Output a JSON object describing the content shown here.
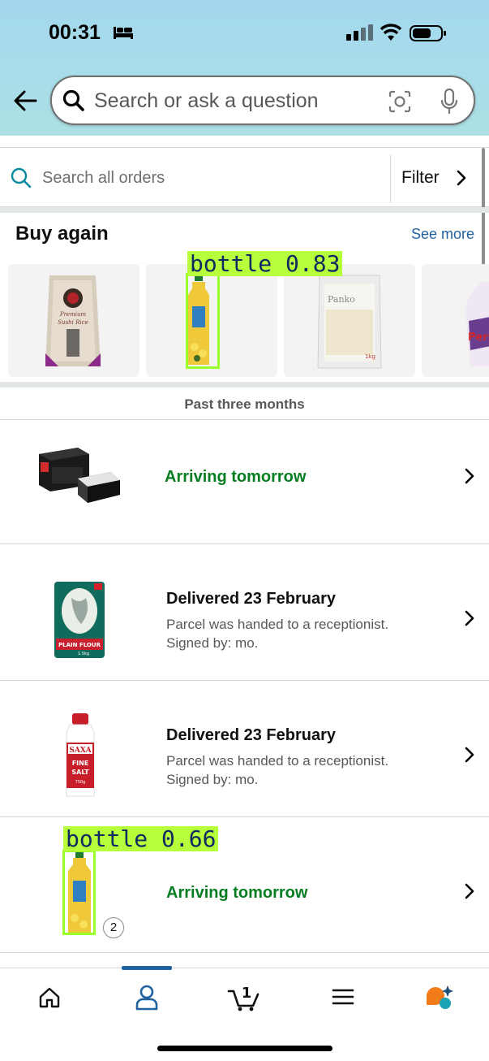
{
  "status_bar": {
    "time": "00:31"
  },
  "header": {
    "search_placeholder": "Search or ask a question"
  },
  "orders_search": {
    "placeholder": "Search all orders",
    "filter_label": "Filter"
  },
  "buy_again": {
    "title": "Buy again",
    "see_more": "See more",
    "products": [
      {
        "name": "Premium Sushi Rice"
      },
      {
        "name": "Vegetable Oil"
      },
      {
        "name": "Panko"
      },
      {
        "name": "Persil"
      }
    ]
  },
  "detections": [
    {
      "label": "bottle 0.83"
    },
    {
      "label": "bottle 0.66"
    }
  ],
  "section_label": "Past three months",
  "orders": [
    {
      "status": "Arriving tomorrow"
    },
    {
      "status": "Delivered 23 February",
      "detail_1": "Parcel was handed to a receptionist.",
      "detail_2": "Signed by: mo."
    },
    {
      "status": "Delivered 23 February",
      "detail_1": "Parcel was handed to a receptionist.",
      "detail_2": "Signed by: mo."
    },
    {
      "status": "Arriving tomorrow",
      "quantity": "2"
    }
  ],
  "bottom_nav": {
    "items": [
      "home-icon",
      "account-icon",
      "cart-icon",
      "menu-icon",
      "rufus-icon"
    ],
    "cart_count": "1",
    "active": "account"
  },
  "colors": {
    "green_status": "#067d20",
    "link": "#2162a1",
    "detection": "#b7ff3b"
  }
}
